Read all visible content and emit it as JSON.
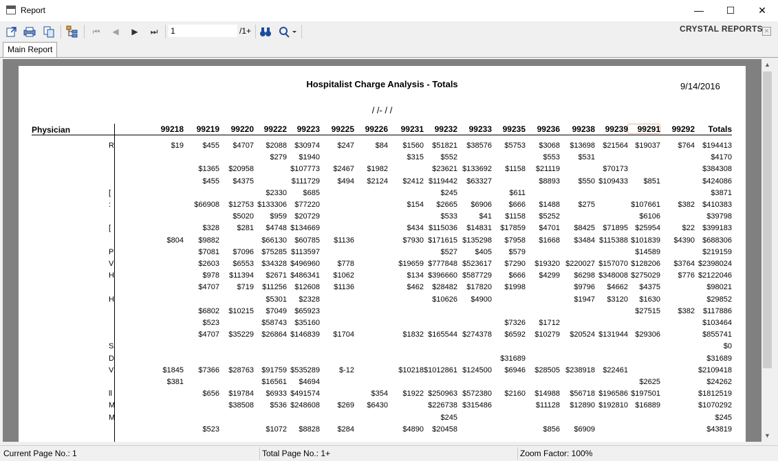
{
  "window": {
    "title": "Report",
    "minimize": "—",
    "maximize": "☐",
    "close": "✕"
  },
  "toolbar": {
    "export_icon": "export-icon",
    "print_icon": "print-icon",
    "copy_icon": "copy-icon",
    "group_tree_icon": "group-tree-icon",
    "first_icon": "⏮",
    "prev_icon": "◀",
    "next_icon": "▶",
    "last_icon": "⏭",
    "page_value": "1",
    "page_total": "/1+",
    "find_icon": "binoculars-icon",
    "zoom_icon": "zoom-icon",
    "brand": "CRYSTAL REPORTS"
  },
  "tabs": [
    {
      "label": "Main Report"
    }
  ],
  "report": {
    "title": "Hospitalist Charge Analysis  - Totals",
    "date": "9/14/2016",
    "range": "/ /-  / /",
    "physician_header": "Physician",
    "columns": [
      "99218",
      "99219",
      "99220",
      "99222",
      "99223",
      "99225",
      "99226",
      "99231",
      "99232",
      "99233",
      "99235",
      "99236",
      "99238",
      "99239",
      "99291",
      "99292",
      "Totals"
    ],
    "rows": [
      {
        "frag": "R",
        "v": [
          "$19",
          "$455",
          "$4707",
          "$2088",
          "$30974",
          "$247",
          "$84",
          "$1560",
          "$51821",
          "$38576",
          "$5753",
          "$3068",
          "$13698",
          "$21564",
          "$19037",
          "$764",
          "$194413"
        ]
      },
      {
        "frag": "",
        "v": [
          "",
          "",
          "",
          "$279",
          "$1940",
          "",
          "",
          "$315",
          "$552",
          "",
          "",
          "$553",
          "$531",
          "",
          "",
          "",
          "$4170"
        ]
      },
      {
        "frag": "",
        "v": [
          "",
          "$1365",
          "$20958",
          "",
          "$107773",
          "$2467",
          "$1982",
          "",
          "$23621",
          "$133692",
          "$1158",
          "$21119",
          "",
          "$70173",
          "",
          "",
          "$384308"
        ]
      },
      {
        "frag": "",
        "v": [
          "",
          "$455",
          "$4375",
          "",
          "$111729",
          "$494",
          "$2124",
          "$2412",
          "$119442",
          "$63327",
          "",
          "$8893",
          "$550",
          "$109433",
          "$851",
          "",
          "$424086"
        ]
      },
      {
        "frag": "[",
        "v": [
          "",
          "",
          "",
          "$2330",
          "$685",
          "",
          "",
          "",
          "$245",
          "",
          "$611",
          "",
          "",
          "",
          "",
          "",
          "$3871"
        ]
      },
      {
        "frag": ":",
        "v": [
          "",
          "$66908",
          "$12753",
          "$133306",
          "$77220",
          "",
          "",
          "$154",
          "$2665",
          "$6906",
          "$666",
          "$1488",
          "$275",
          "",
          "$107661",
          "$382",
          "$410383"
        ]
      },
      {
        "frag": "",
        "v": [
          "",
          "",
          "$5020",
          "$959",
          "$20729",
          "",
          "",
          "",
          "$533",
          "$41",
          "$1158",
          "$5252",
          "",
          "",
          "$6106",
          "",
          "$39798"
        ]
      },
      {
        "frag": "[",
        "v": [
          "",
          "$328",
          "$281",
          "$4748",
          "$134669",
          "",
          "",
          "$434",
          "$115036",
          "$14831",
          "$17859",
          "$4701",
          "$8425",
          "$71895",
          "$25954",
          "$22",
          "$399183"
        ]
      },
      {
        "frag": "",
        "v": [
          "$804",
          "$9882",
          "",
          "$66130",
          "$60785",
          "$1136",
          "",
          "$7930",
          "$171615",
          "$135298",
          "$7958",
          "$1668",
          "$3484",
          "$115388",
          "$101839",
          "$4390",
          "$688306"
        ]
      },
      {
        "frag": "P",
        "v": [
          "",
          "$7081",
          "$7096",
          "$75285",
          "$113597",
          "",
          "",
          "",
          "$527",
          "$405",
          "$579",
          "",
          "",
          "",
          "$14589",
          "",
          "$219159"
        ]
      },
      {
        "frag": "V",
        "v": [
          "",
          "$2603",
          "$6553",
          "$34328",
          "$496960",
          "$778",
          "",
          "$19659",
          "$777848",
          "$523617",
          "$7290",
          "$19320",
          "$220027",
          "$157070",
          "$128206",
          "$3764",
          "$2398024"
        ]
      },
      {
        "frag": "H",
        "v": [
          "",
          "$978",
          "$11394",
          "$2671",
          "$486341",
          "$1062",
          "",
          "$134",
          "$396660",
          "$587729",
          "$666",
          "$4299",
          "$6298",
          "$348008",
          "$275029",
          "$776",
          "$2122046"
        ]
      },
      {
        "frag": "",
        "v": [
          "",
          "$4707",
          "$719",
          "$11256",
          "$12608",
          "$1136",
          "",
          "$462",
          "$28482",
          "$17820",
          "$1998",
          "",
          "$9796",
          "$4662",
          "$4375",
          "",
          "$98021"
        ]
      },
      {
        "frag": "H",
        "v": [
          "",
          "",
          "",
          "$5301",
          "$2328",
          "",
          "",
          "",
          "$10626",
          "$4900",
          "",
          "",
          "$1947",
          "$3120",
          "$1630",
          "",
          "$29852"
        ]
      },
      {
        "frag": "",
        "v": [
          "",
          "$6802",
          "$10215",
          "$7049",
          "$65923",
          "",
          "",
          "",
          "",
          "",
          "",
          "",
          "",
          "",
          "$27515",
          "$382",
          "$117886"
        ]
      },
      {
        "frag": "",
        "v": [
          "",
          "$523",
          "",
          "$58743",
          "$35160",
          "",
          "",
          "",
          "",
          "",
          "$7326",
          "$1712",
          "",
          "",
          "",
          "",
          "$103464"
        ]
      },
      {
        "frag": "",
        "v": [
          "",
          "$4707",
          "$35229",
          "$26864",
          "$146839",
          "$1704",
          "",
          "$1832",
          "$165544",
          "$274378",
          "$6592",
          "$10279",
          "$20524",
          "$131944",
          "$29306",
          "",
          "$855741"
        ]
      },
      {
        "frag": "S",
        "v": [
          "",
          "",
          "",
          "",
          "",
          "",
          "",
          "",
          "",
          "",
          "",
          "",
          "",
          "",
          "",
          "",
          "$0"
        ]
      },
      {
        "frag": "D",
        "v": [
          "",
          "",
          "",
          "",
          "",
          "",
          "",
          "",
          "",
          "",
          "$31689",
          "",
          "",
          "",
          "",
          "",
          "$31689"
        ]
      },
      {
        "frag": "V",
        "v": [
          "$1845",
          "$7366",
          "$28763",
          "$91759",
          "$535289",
          "$-12",
          "",
          "$10218",
          "$1012861",
          "$124500",
          "$6946",
          "$28505",
          "$238918",
          "$22461",
          "",
          "",
          "$2109418"
        ]
      },
      {
        "frag": "",
        "v": [
          "$381",
          "",
          "",
          "$16561",
          "$4694",
          "",
          "",
          "",
          "",
          "",
          "",
          "",
          "",
          "",
          "$2625",
          "",
          "$24262"
        ]
      },
      {
        "frag": "ll",
        "v": [
          "",
          "$656",
          "$19784",
          "$6933",
          "$491574",
          "",
          "$354",
          "$1922",
          "$250963",
          "$572380",
          "$2160",
          "$14988",
          "$56718",
          "$196586",
          "$197501",
          "",
          "$1812519"
        ]
      },
      {
        "frag": "M",
        "v": [
          "",
          "",
          "$38508",
          "$536",
          "$248608",
          "$269",
          "$6430",
          "",
          "$226738",
          "$315486",
          "",
          "$11128",
          "$12890",
          "$192810",
          "$16889",
          "",
          "$1070292"
        ]
      },
      {
        "frag": "M",
        "v": [
          "",
          "",
          "",
          "",
          "",
          "",
          "",
          "",
          "$245",
          "",
          "",
          "",
          "",
          "",
          "",
          "",
          "$245"
        ]
      },
      {
        "frag": "",
        "v": [
          "",
          "$523",
          "",
          "$1072",
          "$8828",
          "$284",
          "",
          "$4890",
          "$20458",
          "",
          "",
          "$856",
          "$6909",
          "",
          "",
          "",
          "$43819"
        ]
      }
    ]
  },
  "status": {
    "current_page": "Current Page No.: 1",
    "total_page": "Total Page No.: 1+",
    "zoom": "Zoom Factor: 100%"
  }
}
